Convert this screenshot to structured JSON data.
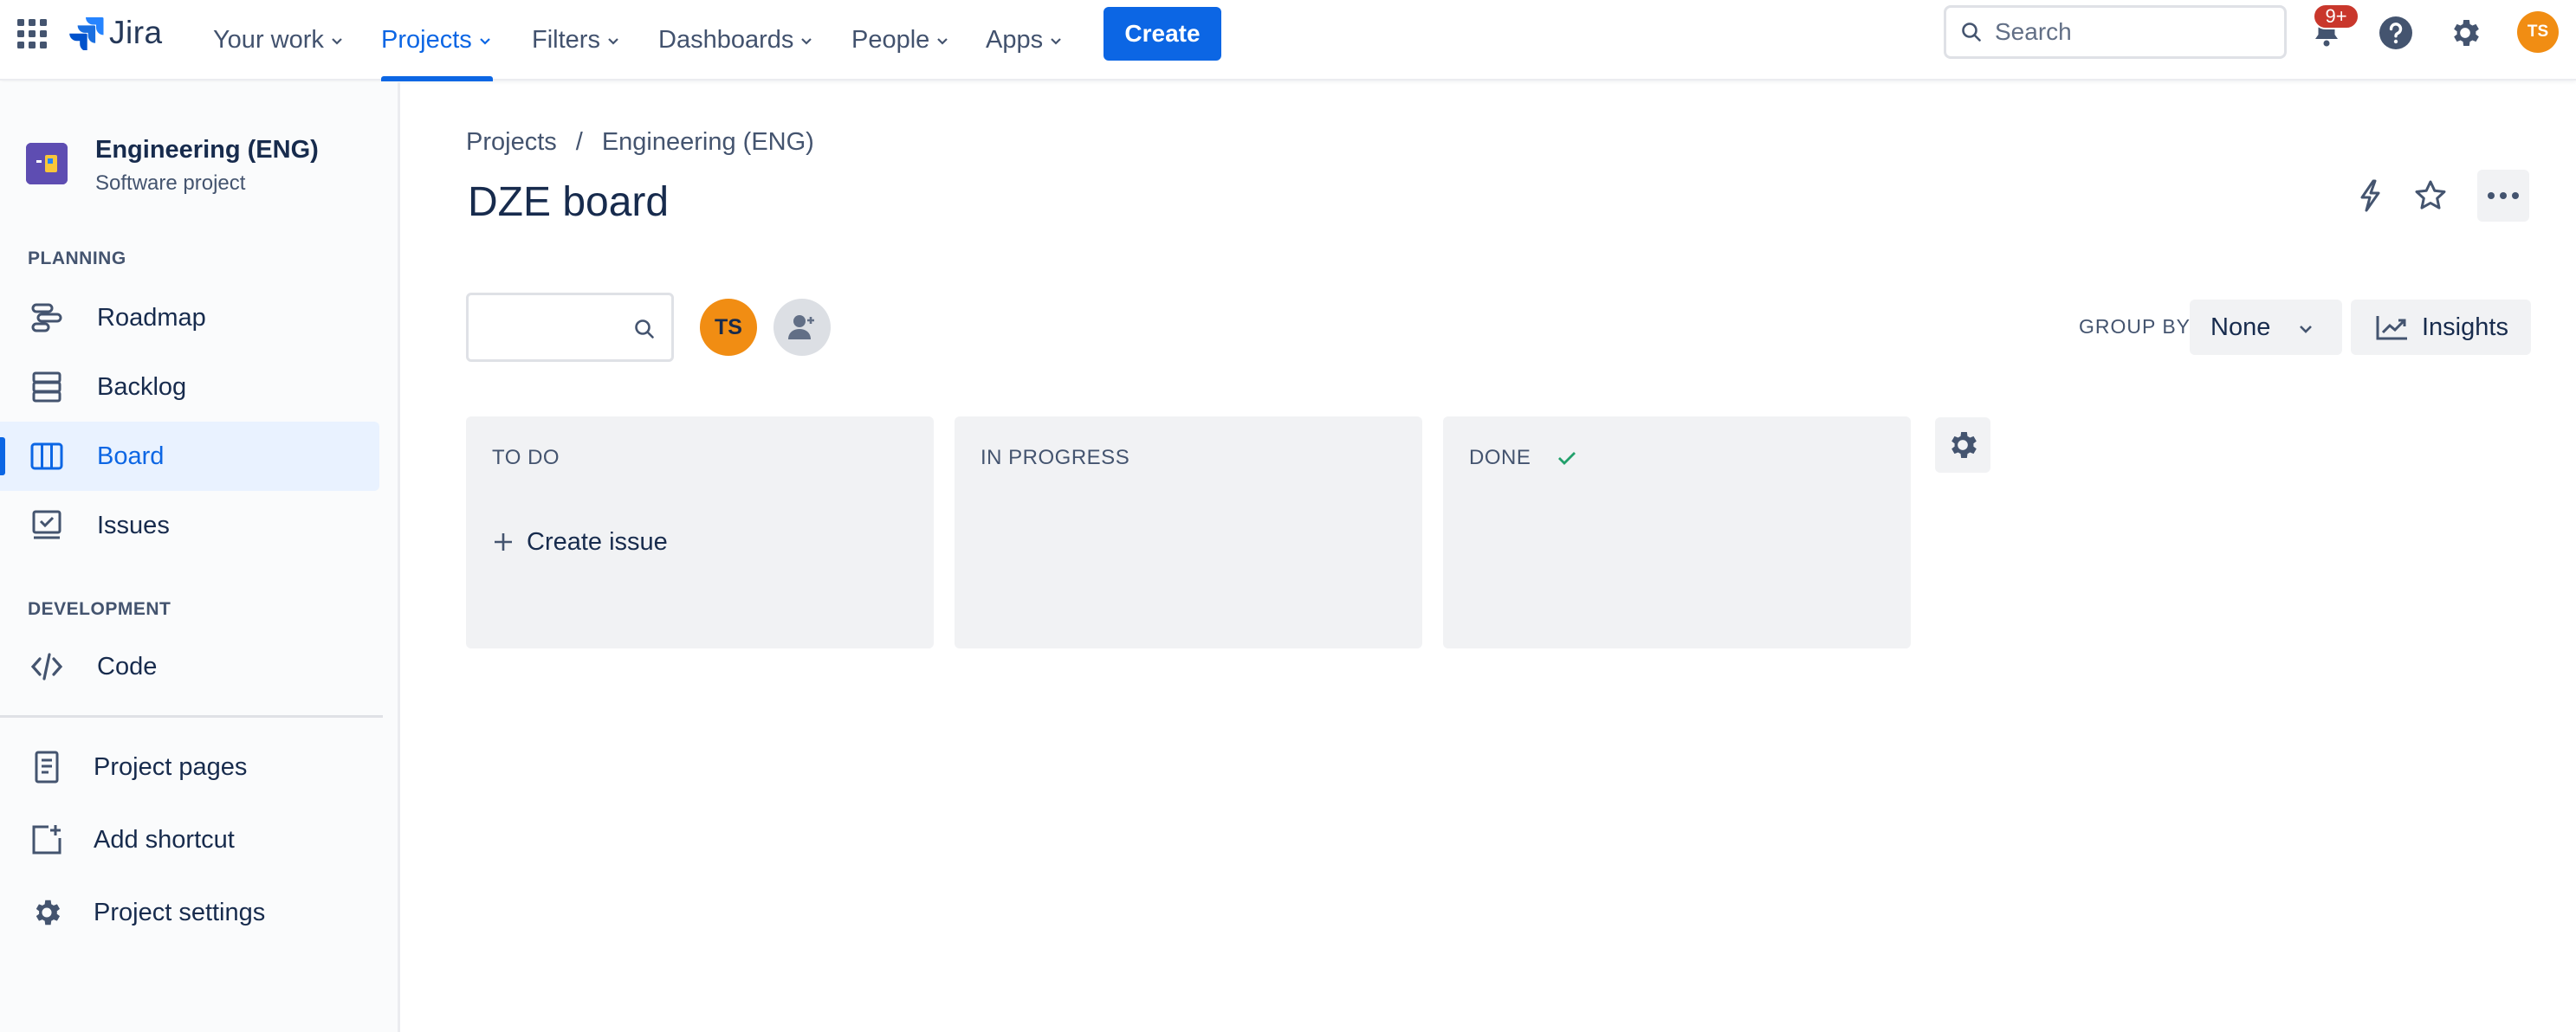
{
  "topnav": {
    "logo_text": "Jira",
    "items": [
      {
        "label": "Your work"
      },
      {
        "label": "Projects"
      },
      {
        "label": "Filters"
      },
      {
        "label": "Dashboards"
      },
      {
        "label": "People"
      },
      {
        "label": "Apps"
      }
    ],
    "create_label": "Create",
    "search_placeholder": "Search",
    "notifications_badge": "9+",
    "user_initials": "TS",
    "accent": "#0c66e4"
  },
  "sidebar": {
    "project_name": "Engineering (ENG)",
    "project_type": "Software project",
    "planning_heading": "PLANNING",
    "planning_items": [
      {
        "label": "Roadmap",
        "icon": "roadmap-icon"
      },
      {
        "label": "Backlog",
        "icon": "backlog-icon"
      },
      {
        "label": "Board",
        "icon": "board-icon"
      },
      {
        "label": "Issues",
        "icon": "issues-icon"
      }
    ],
    "development_heading": "DEVELOPMENT",
    "development_items": [
      {
        "label": "Code",
        "icon": "code-icon"
      }
    ],
    "bottom_items": [
      {
        "label": "Project pages",
        "icon": "project-pages-icon"
      },
      {
        "label": "Add shortcut",
        "icon": "add-shortcut-icon"
      },
      {
        "label": "Project settings",
        "icon": "gear-icon"
      }
    ]
  },
  "main": {
    "breadcrumb": [
      "Projects",
      "Engineering (ENG)"
    ],
    "breadcrumb_separator": "/",
    "title": "DZE board",
    "assignee_initials": "TS",
    "group_by_label": "GROUP BY",
    "group_by_value": "None",
    "insights_label": "Insights",
    "columns": [
      {
        "title": "TO DO"
      },
      {
        "title": "IN PROGRESS"
      },
      {
        "title": "DONE"
      }
    ],
    "create_issue_label": "Create issue"
  }
}
